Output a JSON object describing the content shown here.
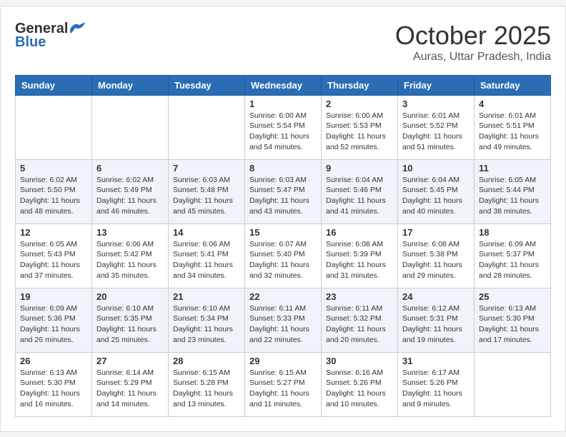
{
  "header": {
    "logo_general": "General",
    "logo_blue": "Blue",
    "month_title": "October 2025",
    "location": "Auras, Uttar Pradesh, India"
  },
  "weekdays": [
    "Sunday",
    "Monday",
    "Tuesday",
    "Wednesday",
    "Thursday",
    "Friday",
    "Saturday"
  ],
  "weeks": [
    [
      {
        "day": "",
        "info": ""
      },
      {
        "day": "",
        "info": ""
      },
      {
        "day": "",
        "info": ""
      },
      {
        "day": "1",
        "info": "Sunrise: 6:00 AM\nSunset: 5:54 PM\nDaylight: 11 hours\nand 54 minutes."
      },
      {
        "day": "2",
        "info": "Sunrise: 6:00 AM\nSunset: 5:53 PM\nDaylight: 11 hours\nand 52 minutes."
      },
      {
        "day": "3",
        "info": "Sunrise: 6:01 AM\nSunset: 5:52 PM\nDaylight: 11 hours\nand 51 minutes."
      },
      {
        "day": "4",
        "info": "Sunrise: 6:01 AM\nSunset: 5:51 PM\nDaylight: 11 hours\nand 49 minutes."
      }
    ],
    [
      {
        "day": "5",
        "info": "Sunrise: 6:02 AM\nSunset: 5:50 PM\nDaylight: 11 hours\nand 48 minutes."
      },
      {
        "day": "6",
        "info": "Sunrise: 6:02 AM\nSunset: 5:49 PM\nDaylight: 11 hours\nand 46 minutes."
      },
      {
        "day": "7",
        "info": "Sunrise: 6:03 AM\nSunset: 5:48 PM\nDaylight: 11 hours\nand 45 minutes."
      },
      {
        "day": "8",
        "info": "Sunrise: 6:03 AM\nSunset: 5:47 PM\nDaylight: 11 hours\nand 43 minutes."
      },
      {
        "day": "9",
        "info": "Sunrise: 6:04 AM\nSunset: 5:46 PM\nDaylight: 11 hours\nand 41 minutes."
      },
      {
        "day": "10",
        "info": "Sunrise: 6:04 AM\nSunset: 5:45 PM\nDaylight: 11 hours\nand 40 minutes."
      },
      {
        "day": "11",
        "info": "Sunrise: 6:05 AM\nSunset: 5:44 PM\nDaylight: 11 hours\nand 38 minutes."
      }
    ],
    [
      {
        "day": "12",
        "info": "Sunrise: 6:05 AM\nSunset: 5:43 PM\nDaylight: 11 hours\nand 37 minutes."
      },
      {
        "day": "13",
        "info": "Sunrise: 6:06 AM\nSunset: 5:42 PM\nDaylight: 11 hours\nand 35 minutes."
      },
      {
        "day": "14",
        "info": "Sunrise: 6:06 AM\nSunset: 5:41 PM\nDaylight: 11 hours\nand 34 minutes."
      },
      {
        "day": "15",
        "info": "Sunrise: 6:07 AM\nSunset: 5:40 PM\nDaylight: 11 hours\nand 32 minutes."
      },
      {
        "day": "16",
        "info": "Sunrise: 6:08 AM\nSunset: 5:39 PM\nDaylight: 11 hours\nand 31 minutes."
      },
      {
        "day": "17",
        "info": "Sunrise: 6:08 AM\nSunset: 5:38 PM\nDaylight: 11 hours\nand 29 minutes."
      },
      {
        "day": "18",
        "info": "Sunrise: 6:09 AM\nSunset: 5:37 PM\nDaylight: 11 hours\nand 28 minutes."
      }
    ],
    [
      {
        "day": "19",
        "info": "Sunrise: 6:09 AM\nSunset: 5:36 PM\nDaylight: 11 hours\nand 26 minutes."
      },
      {
        "day": "20",
        "info": "Sunrise: 6:10 AM\nSunset: 5:35 PM\nDaylight: 11 hours\nand 25 minutes."
      },
      {
        "day": "21",
        "info": "Sunrise: 6:10 AM\nSunset: 5:34 PM\nDaylight: 11 hours\nand 23 minutes."
      },
      {
        "day": "22",
        "info": "Sunrise: 6:11 AM\nSunset: 5:33 PM\nDaylight: 11 hours\nand 22 minutes."
      },
      {
        "day": "23",
        "info": "Sunrise: 6:11 AM\nSunset: 5:32 PM\nDaylight: 11 hours\nand 20 minutes."
      },
      {
        "day": "24",
        "info": "Sunrise: 6:12 AM\nSunset: 5:31 PM\nDaylight: 11 hours\nand 19 minutes."
      },
      {
        "day": "25",
        "info": "Sunrise: 6:13 AM\nSunset: 5:30 PM\nDaylight: 11 hours\nand 17 minutes."
      }
    ],
    [
      {
        "day": "26",
        "info": "Sunrise: 6:13 AM\nSunset: 5:30 PM\nDaylight: 11 hours\nand 16 minutes."
      },
      {
        "day": "27",
        "info": "Sunrise: 6:14 AM\nSunset: 5:29 PM\nDaylight: 11 hours\nand 14 minutes."
      },
      {
        "day": "28",
        "info": "Sunrise: 6:15 AM\nSunset: 5:28 PM\nDaylight: 11 hours\nand 13 minutes."
      },
      {
        "day": "29",
        "info": "Sunrise: 6:15 AM\nSunset: 5:27 PM\nDaylight: 11 hours\nand 11 minutes."
      },
      {
        "day": "30",
        "info": "Sunrise: 6:16 AM\nSunset: 5:26 PM\nDaylight: 11 hours\nand 10 minutes."
      },
      {
        "day": "31",
        "info": "Sunrise: 6:17 AM\nSunset: 5:26 PM\nDaylight: 11 hours\nand 9 minutes."
      },
      {
        "day": "",
        "info": ""
      }
    ]
  ]
}
